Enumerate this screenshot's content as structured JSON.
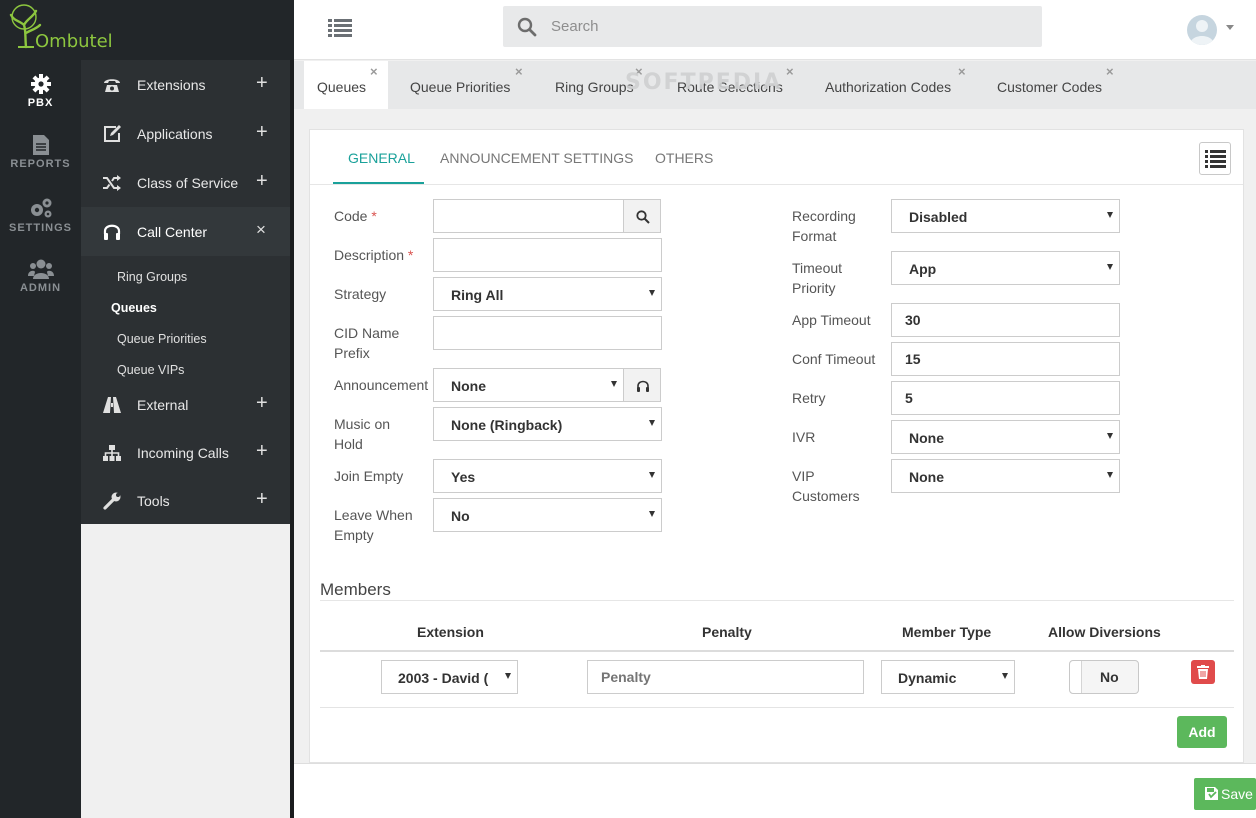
{
  "app": {
    "brand": "Ombutel"
  },
  "rail": [
    {
      "label": "PBX",
      "icon": "gear-icon",
      "active": true
    },
    {
      "label": "REPORTS",
      "icon": "document-icon"
    },
    {
      "label": "SETTINGS",
      "icon": "gears-icon"
    },
    {
      "label": "ADMIN",
      "icon": "users-icon"
    }
  ],
  "menu": {
    "items": [
      {
        "label": "Extensions",
        "icon": "phone-icon",
        "toggle": "+"
      },
      {
        "label": "Applications",
        "icon": "edit-icon",
        "toggle": "+"
      },
      {
        "label": "Class of Service",
        "icon": "shuffle-icon",
        "toggle": "+"
      },
      {
        "label": "Call Center",
        "icon": "headset-icon",
        "toggle": "×"
      },
      {
        "label": "External",
        "icon": "road-icon",
        "toggle": "+"
      },
      {
        "label": "Incoming Calls",
        "icon": "sitemap-icon",
        "toggle": "+"
      },
      {
        "label": "Tools",
        "icon": "wrench-icon",
        "toggle": "+"
      }
    ],
    "sub": [
      "Ring Groups",
      "Queues",
      "Queue Priorities",
      "Queue VIPs"
    ]
  },
  "search": {
    "placeholder": "Search"
  },
  "tabs": [
    "Queues",
    "Queue Priorities",
    "Ring Groups",
    "Route Selections",
    "Authorization Codes",
    "Customer Codes"
  ],
  "tab_close": "×",
  "watermark": "SOFTPEDIA",
  "inner_tabs": [
    "GENERAL",
    "ANNOUNCEMENT SETTINGS",
    "OTHERS"
  ],
  "form": {
    "required_mark": "*",
    "code": {
      "label": "Code",
      "value": ""
    },
    "description": {
      "label": "Description",
      "value": ""
    },
    "strategy": {
      "label": "Strategy",
      "value": "Ring All"
    },
    "cid_name_prefix": {
      "label_1": "CID Name",
      "label_2": "Prefix",
      "value": ""
    },
    "announcement": {
      "label": "Announcement",
      "value": "None"
    },
    "music_on_hold": {
      "label_1": "Music on",
      "label_2": "Hold",
      "value": "None (Ringback)"
    },
    "join_empty": {
      "label": "Join Empty",
      "value": "Yes"
    },
    "leave_when_empty": {
      "label_1": "Leave When",
      "label_2": "Empty",
      "value": "No"
    },
    "recording_format": {
      "label_1": "Recording",
      "label_2": "Format",
      "value": "Disabled"
    },
    "timeout_priority": {
      "label_1": "Timeout",
      "label_2": "Priority",
      "value": "App"
    },
    "app_timeout": {
      "label": "App Timeout",
      "value": "30"
    },
    "conf_timeout": {
      "label": "Conf Timeout",
      "value": "15"
    },
    "retry": {
      "label": "Retry",
      "value": "5"
    },
    "ivr": {
      "label": "IVR",
      "value": "None"
    },
    "vip_customers": {
      "label_1": "VIP",
      "label_2": "Customers",
      "value": "None"
    }
  },
  "members": {
    "title": "Members",
    "headers": [
      "Extension",
      "Penalty",
      "Member Type",
      "Allow Diversions"
    ],
    "row": {
      "extension": "2003 - David (",
      "penalty_placeholder": "Penalty",
      "member_type": "Dynamic",
      "allow_diversions": "No"
    },
    "add_label": "Add"
  },
  "save_label": "Save"
}
